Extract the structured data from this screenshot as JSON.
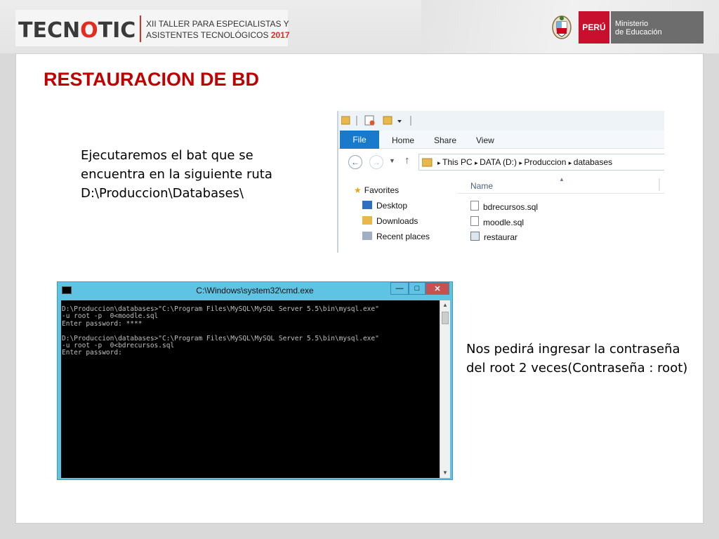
{
  "header": {
    "logo_left": "TECN",
    "logo_mid": "O",
    "logo_right": "TIC",
    "event_line1": "XII TALLER PARA  ESPECIALISTAS  Y",
    "event_line2": "ASISTENTES TECNOLÓGICOS",
    "event_year": "2017",
    "peru": "PERÚ",
    "ministry_line1": "Ministerio",
    "ministry_line2": "de Educación"
  },
  "slide": {
    "title": "RESTAURACION DE BD",
    "para1": [
      "Ejecutaremos el bat que se",
      "encuentra en la siguiente ruta",
      "D:\\Produccion\\Databases\\"
    ],
    "para2": [
      "Nos pedirá ingresar la contraseña",
      "del root 2 veces(Contraseña : root)"
    ]
  },
  "explorer": {
    "tabs": [
      "File",
      "Home",
      "Share",
      "View"
    ],
    "address": [
      "This PC",
      "DATA (D:)",
      "Produccion",
      "databases"
    ],
    "column_name": "Name",
    "sidebar": [
      "Favorites",
      "Desktop",
      "Downloads",
      "Recent places"
    ],
    "files": [
      "bdrecursos.sql",
      "moodle.sql",
      "restaurar"
    ]
  },
  "cmd": {
    "title": "C:\\Windows\\system32\\cmd.exe",
    "lines": [
      "D:\\Produccion\\databases>\"C:\\Program Files\\MySQL\\MySQL Server 5.5\\bin\\mysql.exe\"",
      "-u root -p  0<moodle.sql",
      "Enter password: ****",
      "",
      "D:\\Produccion\\databases>\"C:\\Program Files\\MySQL\\MySQL Server 5.5\\bin\\mysql.exe\"",
      "-u root -p  0<bdrecursos.sql",
      "Enter password:"
    ]
  },
  "colors": {
    "title": "#c00000",
    "brand_red": "#e32b22",
    "cmd_frame": "#5fc3e4",
    "ministry_gray": "#6d6d6d"
  }
}
